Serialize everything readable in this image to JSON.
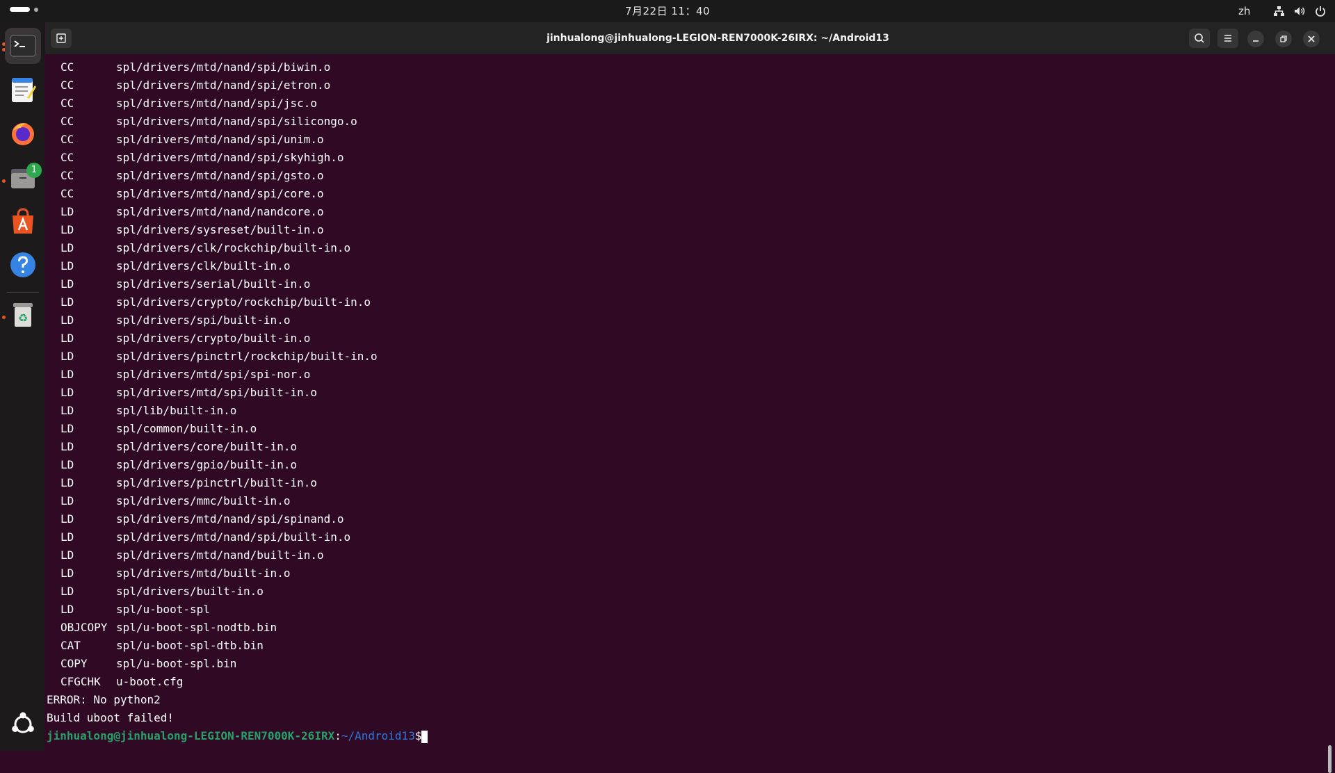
{
  "topbar": {
    "clock": "7月22日 11：40",
    "language": "zh",
    "tray_icons": [
      "network-icon",
      "volume-icon",
      "power-icon"
    ]
  },
  "dock": {
    "items": [
      "terminal",
      "text-editor",
      "firefox",
      "files",
      "app-center",
      "help",
      "trash"
    ],
    "files_badge": "1"
  },
  "window": {
    "title": "jinhualong@jinhualong-LEGION-REN7000K-26IRX: ~/Android13"
  },
  "terminal": {
    "build_lines": [
      {
        "cmd": "CC",
        "path": "spl/drivers/mtd/nand/spi/biwin.o"
      },
      {
        "cmd": "CC",
        "path": "spl/drivers/mtd/nand/spi/etron.o"
      },
      {
        "cmd": "CC",
        "path": "spl/drivers/mtd/nand/spi/jsc.o"
      },
      {
        "cmd": "CC",
        "path": "spl/drivers/mtd/nand/spi/silicongo.o"
      },
      {
        "cmd": "CC",
        "path": "spl/drivers/mtd/nand/spi/unim.o"
      },
      {
        "cmd": "CC",
        "path": "spl/drivers/mtd/nand/spi/skyhigh.o"
      },
      {
        "cmd": "CC",
        "path": "spl/drivers/mtd/nand/spi/gsto.o"
      },
      {
        "cmd": "CC",
        "path": "spl/drivers/mtd/nand/spi/core.o"
      },
      {
        "cmd": "LD",
        "path": "spl/drivers/mtd/nand/nandcore.o"
      },
      {
        "cmd": "LD",
        "path": "spl/drivers/sysreset/built-in.o"
      },
      {
        "cmd": "LD",
        "path": "spl/drivers/clk/rockchip/built-in.o"
      },
      {
        "cmd": "LD",
        "path": "spl/drivers/clk/built-in.o"
      },
      {
        "cmd": "LD",
        "path": "spl/drivers/serial/built-in.o"
      },
      {
        "cmd": "LD",
        "path": "spl/drivers/crypto/rockchip/built-in.o"
      },
      {
        "cmd": "LD",
        "path": "spl/drivers/spi/built-in.o"
      },
      {
        "cmd": "LD",
        "path": "spl/drivers/crypto/built-in.o"
      },
      {
        "cmd": "LD",
        "path": "spl/drivers/pinctrl/rockchip/built-in.o"
      },
      {
        "cmd": "LD",
        "path": "spl/drivers/mtd/spi/spi-nor.o"
      },
      {
        "cmd": "LD",
        "path": "spl/drivers/mtd/spi/built-in.o"
      },
      {
        "cmd": "LD",
        "path": "spl/lib/built-in.o"
      },
      {
        "cmd": "LD",
        "path": "spl/common/built-in.o"
      },
      {
        "cmd": "LD",
        "path": "spl/drivers/core/built-in.o"
      },
      {
        "cmd": "LD",
        "path": "spl/drivers/gpio/built-in.o"
      },
      {
        "cmd": "LD",
        "path": "spl/drivers/pinctrl/built-in.o"
      },
      {
        "cmd": "LD",
        "path": "spl/drivers/mmc/built-in.o"
      },
      {
        "cmd": "LD",
        "path": "spl/drivers/mtd/nand/spi/spinand.o"
      },
      {
        "cmd": "LD",
        "path": "spl/drivers/mtd/nand/spi/built-in.o"
      },
      {
        "cmd": "LD",
        "path": "spl/drivers/mtd/nand/built-in.o"
      },
      {
        "cmd": "LD",
        "path": "spl/drivers/mtd/built-in.o"
      },
      {
        "cmd": "LD",
        "path": "spl/drivers/built-in.o"
      },
      {
        "cmd": "LD",
        "path": "spl/u-boot-spl"
      },
      {
        "cmd": "OBJCOPY",
        "path": "spl/u-boot-spl-nodtb.bin"
      },
      {
        "cmd": "CAT",
        "path": "spl/u-boot-spl-dtb.bin"
      },
      {
        "cmd": "COPY",
        "path": "spl/u-boot-spl.bin"
      },
      {
        "cmd": "CFGCHK",
        "path": "u-boot.cfg"
      }
    ],
    "error_line": "ERROR: No python2",
    "failed_line": "Build uboot failed!",
    "prompt": {
      "user_host": "jinhualong@jinhualong-LEGION-REN7000K-26IRX",
      "separator": ":",
      "path": "~/Android13",
      "symbol": "$"
    }
  }
}
